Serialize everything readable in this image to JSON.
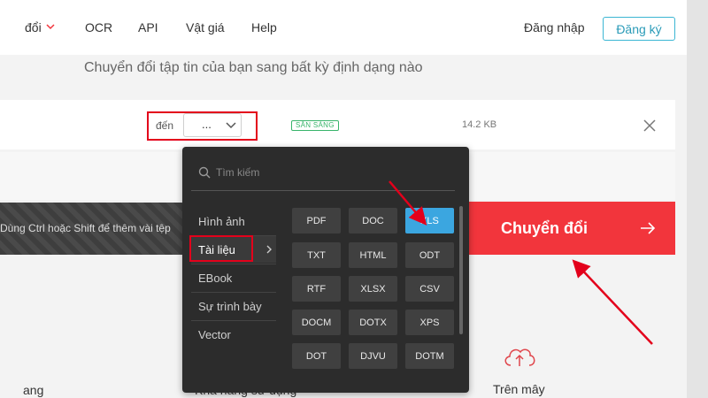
{
  "nav": {
    "items": [
      "đổi",
      "OCR",
      "API",
      "Vật giá",
      "Help"
    ],
    "login": "Đăng nhập",
    "signup": "Đăng ký",
    "accent": "#f2353c"
  },
  "subtitle": "Chuyển đổi tập tin của bạn sang bất kỳ định dạng nào",
  "file": {
    "to_label": "đến",
    "format_value": "...",
    "status": "SẴN SÀNG",
    "size": "14.2 KB"
  },
  "hint": "Dùng Ctrl hoặc Shift để thêm vài tệp",
  "convert": {
    "label": "Chuyển đổi",
    "color": "#f2353c"
  },
  "features": {
    "left": "ang",
    "middle": "Khả năng sử dụng",
    "cloud": "Trên mây"
  },
  "dropdown": {
    "search_placeholder": "Tìm kiếm",
    "categories": [
      "Hình ảnh",
      "Tài liệu",
      "EBook",
      "Sự trình bày",
      "Vector"
    ],
    "active_category": "Tài liệu",
    "formats": [
      "PDF",
      "DOC",
      "XLS",
      "TXT",
      "HTML",
      "ODT",
      "RTF",
      "XLSX",
      "CSV",
      "DOCM",
      "DOTX",
      "XPS",
      "DOT",
      "DJVU",
      "DOTM"
    ],
    "selected_format": "XLS",
    "selected_color": "#3ba6e0"
  }
}
